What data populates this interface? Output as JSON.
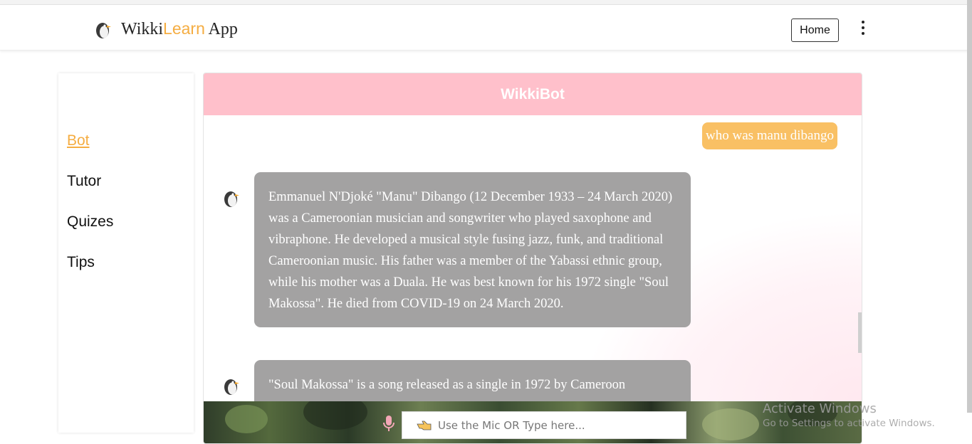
{
  "brand": {
    "prefix": "Wikki",
    "accent": "Learn",
    "suffix": " App",
    "logo_icon": "penguin-icon"
  },
  "nav": {
    "home_label": "Home",
    "menu_icon": "kebab-menu-icon"
  },
  "sidebar": {
    "items": [
      {
        "label": "Bot",
        "active": true
      },
      {
        "label": "Tutor",
        "active": false
      },
      {
        "label": "Quizes",
        "active": false
      },
      {
        "label": "Tips",
        "active": false
      }
    ]
  },
  "chat": {
    "title": "WikkiBot",
    "messages": [
      {
        "from": "user",
        "text": "who was manu dibango"
      },
      {
        "from": "bot",
        "text": "Emmanuel N'Djoké \"Manu\" Dibango (12 December 1933 – 24 March 2020) was a Cameroonian musician and songwriter who played saxophone and vibraphone. He developed a musical style fusing jazz, funk, and traditional Cameroonian music. His father was a member of the Yabassi ethnic group, while his mother was a Duala. He was best known for his 1972 single \"Soul Makossa\". He died from COVID-19 on 24 March 2020."
      },
      {
        "from": "bot",
        "text": "\"Soul Makossa\" is a song released as a single in 1972 by Cameroon"
      }
    ],
    "input": {
      "placeholder": "Use the Mic OR Type here...",
      "value": ""
    }
  },
  "watermark": {
    "line1": "Activate Windows",
    "line2": "Go to Settings to activate Windows."
  },
  "colors": {
    "accent": "#f5ad42",
    "header": "#ffc0cb",
    "user_bubble": "#f9c064",
    "bot_bubble": "#a3a2a2"
  }
}
